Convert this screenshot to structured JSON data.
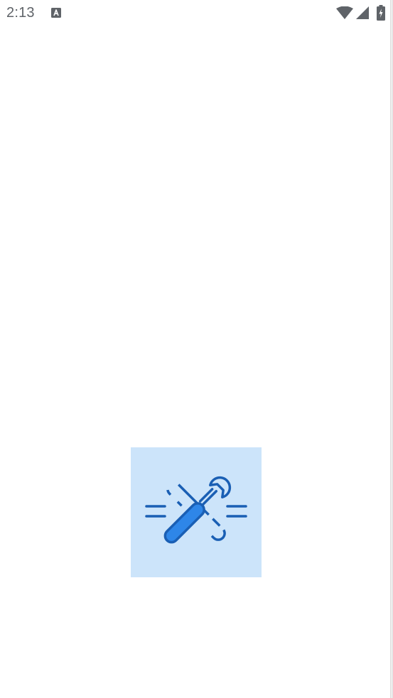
{
  "status_bar": {
    "time": "2:13",
    "notification_icon": "accessibility-a-icon",
    "wifi_icon": "wifi-icon",
    "signal_icon": "cellular-signal-icon",
    "battery_icon": "battery-charging-icon"
  },
  "splash": {
    "logo_icon": "tools-screwdriver-wrench-icon",
    "colors": {
      "logo_background": "#cce4fa",
      "logo_stroke": "#1a5fb4",
      "logo_fill": "#2e86e8"
    }
  }
}
